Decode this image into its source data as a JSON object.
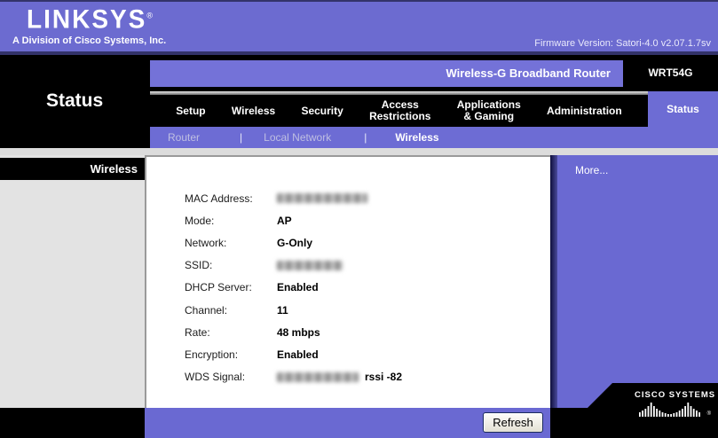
{
  "header": {
    "logo": "LINKSYS",
    "logo_reg": "®",
    "tagline": "A Division of Cisco Systems, Inc.",
    "firmware": "Firmware Version: Satori-4.0 v2.07.1.7sv"
  },
  "banner": {
    "product": "Wireless-G Broadband Router",
    "model": "WRT54G"
  },
  "sidebar": {
    "title": "Status",
    "section": "Wireless"
  },
  "nav": {
    "tabs": [
      {
        "label": "Setup",
        "active": false
      },
      {
        "label": "Wireless",
        "active": false
      },
      {
        "label": "Security",
        "active": false
      },
      {
        "label": "Access\nRestrictions",
        "active": false
      },
      {
        "label": "Applications\n& Gaming",
        "active": false
      },
      {
        "label": "Administration",
        "active": false
      },
      {
        "label": "Status",
        "active": true
      }
    ]
  },
  "subnav": {
    "separator": "|",
    "items": [
      {
        "label": "Router",
        "active": false
      },
      {
        "label": "Local Network",
        "active": false
      },
      {
        "label": "Wireless",
        "active": true
      }
    ]
  },
  "main": {
    "rows": [
      {
        "label": "MAC Address:",
        "value": "",
        "blurred": true
      },
      {
        "label": "Mode:",
        "value": "AP",
        "blurred": false
      },
      {
        "label": "Network:",
        "value": "G-Only",
        "blurred": false
      },
      {
        "label": "SSID:",
        "value": "",
        "blurred": true
      },
      {
        "label": "DHCP Server:",
        "value": "Enabled",
        "blurred": false
      },
      {
        "label": "Channel:",
        "value": "11",
        "blurred": false
      },
      {
        "label": "Rate:",
        "value": "48 mbps",
        "blurred": false
      },
      {
        "label": "Encryption:",
        "value": "Enabled",
        "blurred": false
      },
      {
        "label": "WDS Signal:",
        "value": "",
        "blurred": true,
        "suffix": "rssi -82"
      }
    ],
    "refresh_label": "Refresh"
  },
  "help": {
    "more_label": "More..."
  },
  "footer": {
    "cisco_brand": "Cisco Systems",
    "cisco_reg": "®"
  },
  "colors": {
    "purple": "#6c6bd0",
    "nav_black": "#000000",
    "sidebar_gray": "#e3e3e3",
    "divider_navy": "#0f0f3d"
  }
}
